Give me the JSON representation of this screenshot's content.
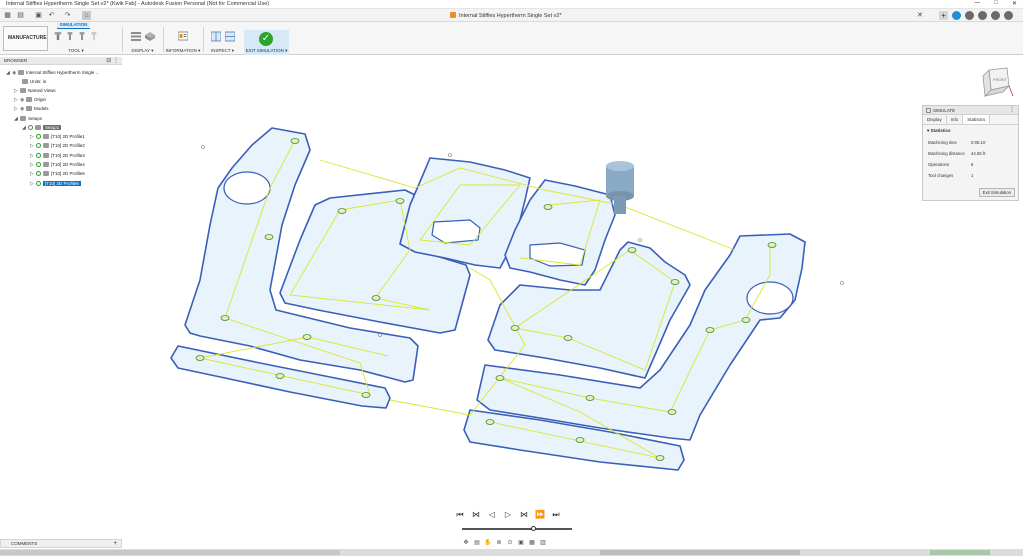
{
  "window": {
    "title": "Internal Stiffies Hypertherm Single Set v2* (Kwik Fab) - Autodesk Fusion Personal (Not for Commercial Use)",
    "controls": [
      "—",
      "□",
      "✕"
    ]
  },
  "document_tab": {
    "label": "Internal Stiffies Hypertherm Single Set v2*",
    "close": "✕"
  },
  "ribbon": {
    "workspace": "MANUFACTURE",
    "active_tab": "SIMULATION",
    "groups": [
      {
        "label": "TOOL ▾"
      },
      {
        "label": "DISPLAY ▾"
      },
      {
        "label": "INFORMATION ▾"
      },
      {
        "label": "INSPECT ▾"
      },
      {
        "label": "EXIT SIMULATION ▾"
      }
    ]
  },
  "browser": {
    "header": "BROWSER",
    "items": [
      {
        "label": "Internal Stiffies Hypertherm Single ..."
      },
      {
        "label": "Units: in"
      },
      {
        "label": "Named Views"
      },
      {
        "label": "Origin"
      },
      {
        "label": "Models"
      },
      {
        "label": "Setups"
      },
      {
        "label": "Setup1"
      },
      {
        "label": "[T10] 2D Profile1"
      },
      {
        "label": "[T10] 2D Profile2"
      },
      {
        "label": "[T10] 2D Profile3"
      },
      {
        "label": "[T10] 2D Profile4"
      },
      {
        "label": "[T10] 2D Profile5"
      },
      {
        "label": "[T10] 2D Profile6"
      }
    ]
  },
  "simulate_panel": {
    "title": "SIMULATE",
    "tabs": [
      "Display",
      "Info",
      "Statistics"
    ],
    "section": "Statistics",
    "stats": [
      {
        "key": "Machining time",
        "value": "0:05:10"
      },
      {
        "key": "Machining distance",
        "value": "44.55 ft"
      },
      {
        "key": "Operations",
        "value": "6"
      },
      {
        "key": "Tool changes",
        "value": "1"
      }
    ],
    "exit_button": "Exit Simulation"
  },
  "navcube": {
    "face": "FRONT"
  },
  "comments": {
    "label": "COMMENTS",
    "add": "+"
  },
  "colors": {
    "accent": "#0a74c9",
    "part_outline": "#3a5fb8",
    "part_fill": "#e9f3fb",
    "toolpath": "#d8e830",
    "tool": "#8aa9c4",
    "exit_green": "#2aa52a"
  }
}
